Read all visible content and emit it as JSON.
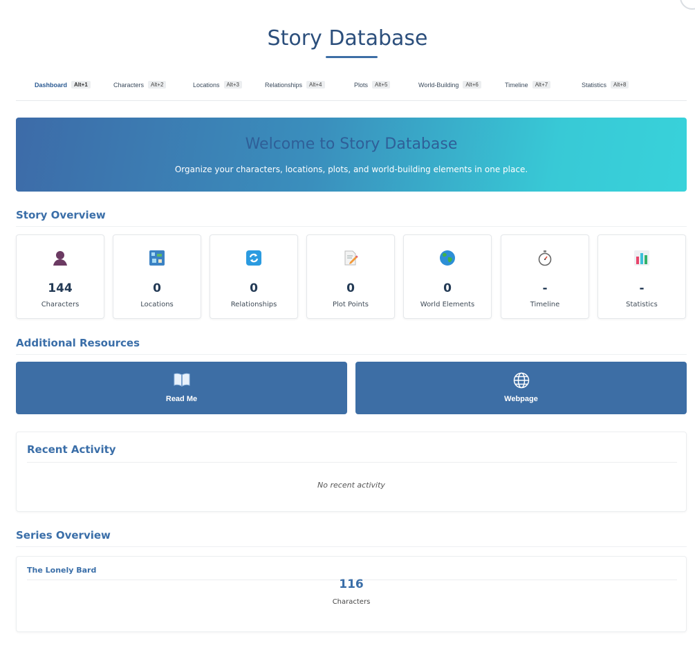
{
  "app": {
    "title": "Story Database"
  },
  "nav": [
    {
      "label": "Dashboard",
      "shortcut": "Alt+1",
      "active": true
    },
    {
      "label": "Characters",
      "shortcut": "Alt+2"
    },
    {
      "label": "Locations",
      "shortcut": "Alt+3"
    },
    {
      "label": "Relationships",
      "shortcut": "Alt+4"
    },
    {
      "label": "Plots",
      "shortcut": "Alt+5"
    },
    {
      "label": "World-Building",
      "shortcut": "Alt+6"
    },
    {
      "label": "Timeline",
      "shortcut": "Alt+7"
    },
    {
      "label": "Statistics",
      "shortcut": "Alt+8"
    }
  ],
  "banner": {
    "title": "Welcome to Story Database",
    "subtitle": "Organize your characters, locations, plots, and world-building elements in one place."
  },
  "overview": {
    "title": "Story Overview",
    "cards": [
      {
        "icon": "person-icon",
        "value": "144",
        "label": "Characters"
      },
      {
        "icon": "map-icon",
        "value": "0",
        "label": "Locations"
      },
      {
        "icon": "cycle-arrows-icon",
        "value": "0",
        "label": "Relationships"
      },
      {
        "icon": "memo-icon",
        "value": "0",
        "label": "Plot Points"
      },
      {
        "icon": "globe-icon",
        "value": "0",
        "label": "World Elements"
      },
      {
        "icon": "stopwatch-icon",
        "value": "-",
        "label": "Timeline"
      },
      {
        "icon": "bar-chart-icon",
        "value": "-",
        "label": "Statistics"
      }
    ]
  },
  "resources": {
    "title": "Additional Resources",
    "buttons": [
      {
        "icon": "open-book-icon",
        "label": "Read Me"
      },
      {
        "icon": "globe-lines-icon",
        "label": "Webpage"
      }
    ]
  },
  "recent": {
    "title": "Recent Activity",
    "empty": "No recent activity"
  },
  "series": {
    "title": "Series Overview",
    "items": [
      {
        "name": "The Lonely Bard",
        "count": "116",
        "count_label": "Characters"
      }
    ]
  },
  "colors": {
    "primary": "#3d6ea5",
    "heading": "#3a6ea8",
    "banner_start": "#3d6ba8",
    "banner_end": "#38d2da"
  }
}
